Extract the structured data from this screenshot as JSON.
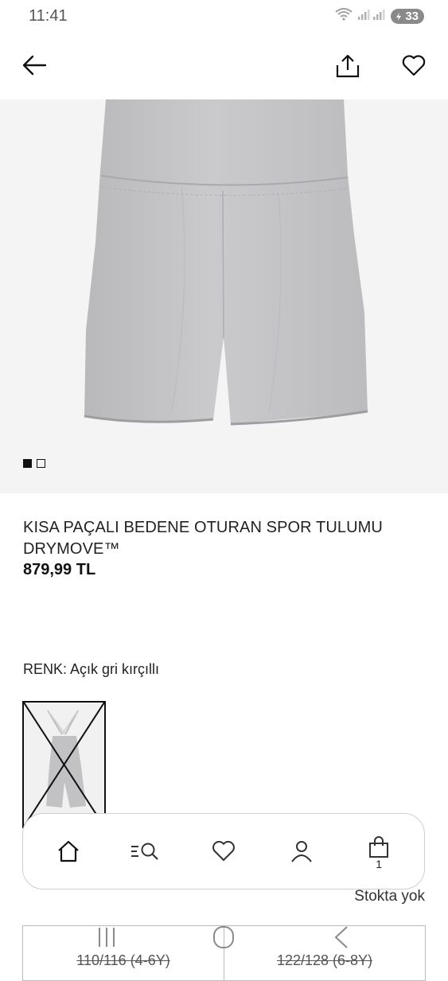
{
  "status_bar": {
    "time": "11:41",
    "battery": "33",
    "wifi_icon": "wifi-icon",
    "signal_icon": "signal-icon"
  },
  "top_bar": {
    "back_icon": "arrow-left-icon",
    "share_icon": "share-icon",
    "favorite_icon": "heart-icon"
  },
  "product": {
    "title": "KISA PAÇALI BEDENE OTURAN SPOR TULUMU DRYMOVE™",
    "price": "879,99 TL",
    "color_label": "RENK: Açık gri kırçıllı",
    "image_count": 2,
    "active_image_index": 0,
    "fabric_color": "#c4c4c6"
  },
  "bottom_nav": {
    "items": [
      {
        "icon": "home-icon"
      },
      {
        "icon": "search-menu-icon"
      },
      {
        "icon": "heart-icon"
      },
      {
        "icon": "user-icon"
      },
      {
        "icon": "bag-icon",
        "count": "1"
      }
    ]
  },
  "stock": {
    "text": "Stokta yok"
  },
  "sizes": [
    {
      "label": "110/116 (4-6Y)"
    },
    {
      "label": "122/128 (6-8Y)"
    }
  ],
  "system_nav": {
    "recents_icon": "recents-icon",
    "home_icon": "system-home-icon",
    "back_icon": "system-back-icon"
  }
}
